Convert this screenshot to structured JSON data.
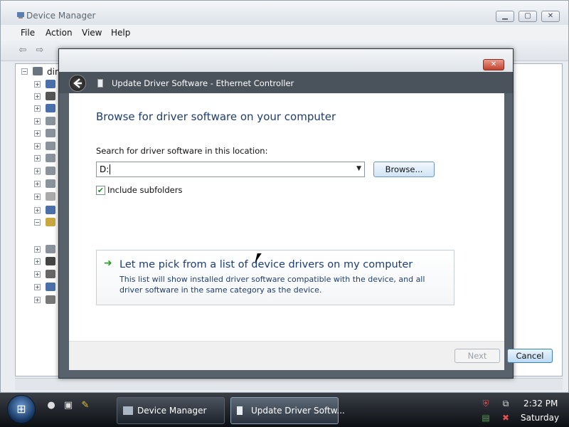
{
  "device_manager": {
    "title": "Device Manager",
    "menu": [
      "File",
      "Action",
      "View",
      "Help"
    ],
    "tree_root": "din"
  },
  "dialog": {
    "header_title": "Update Driver Software - Ethernet Controller",
    "heading": "Browse for driver software on your computer",
    "search_label": "Search for driver software in this location:",
    "path_value": "D:",
    "browse_label": "Browse...",
    "include_subfolders_label": "Include subfolders",
    "include_subfolders_checked": true,
    "pick_title": "Let me pick from a list of device drivers on my computer",
    "pick_description": "This list will show installed driver software compatible with the device, and all driver software in the same category as the device.",
    "next_label": "Next",
    "cancel_label": "Cancel"
  },
  "taskbar": {
    "buttons": [
      "Device Manager",
      "Update Driver Softw..."
    ],
    "active_index": 1,
    "time": "2:32 PM",
    "day": "Saturday"
  },
  "colors": {
    "heading": "#1e3e70",
    "header_bar": "#4a525c",
    "accent_arrow": "#2aa02a"
  }
}
